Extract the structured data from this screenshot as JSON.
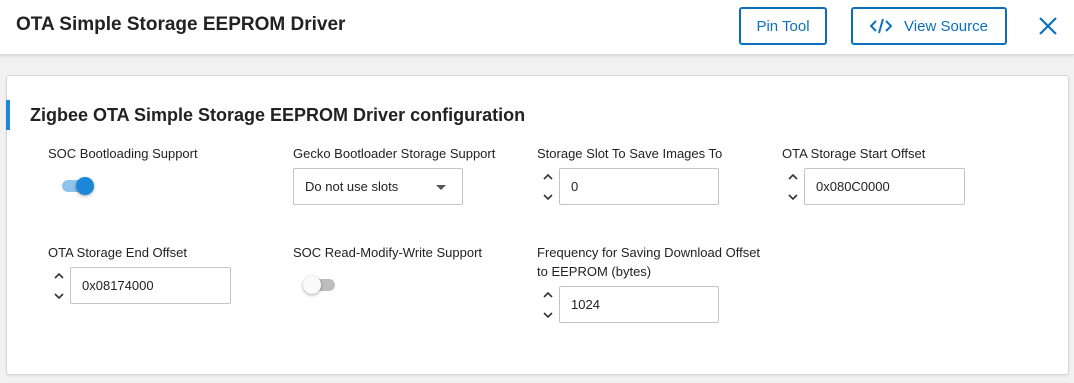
{
  "header": {
    "title": "OTA Simple Storage EEPROM Driver",
    "pin_tool_label": "Pin Tool",
    "view_source_label": "View Source",
    "accent_color": "#0b6fbc"
  },
  "config": {
    "title": "Zigbee OTA Simple Storage EEPROM Driver configuration",
    "soc_bootloading": {
      "label": "SOC Bootloading Support",
      "enabled": true
    },
    "gecko_storage": {
      "label": "Gecko Bootloader Storage Support",
      "value": "Do not use slots"
    },
    "storage_slot": {
      "label": "Storage Slot To Save Images To",
      "value": "0"
    },
    "start_offset": {
      "label": "OTA Storage Start Offset",
      "value": "0x080C0000"
    },
    "end_offset": {
      "label": "OTA Storage End Offset",
      "value": "0x08174000"
    },
    "rmw_support": {
      "label": "SOC Read-Modify-Write Support",
      "enabled": false
    },
    "save_frequency": {
      "label_line1": "Frequency for Saving Download Offset",
      "label_line2": "to EEPROM (bytes)",
      "value": "1024"
    }
  }
}
